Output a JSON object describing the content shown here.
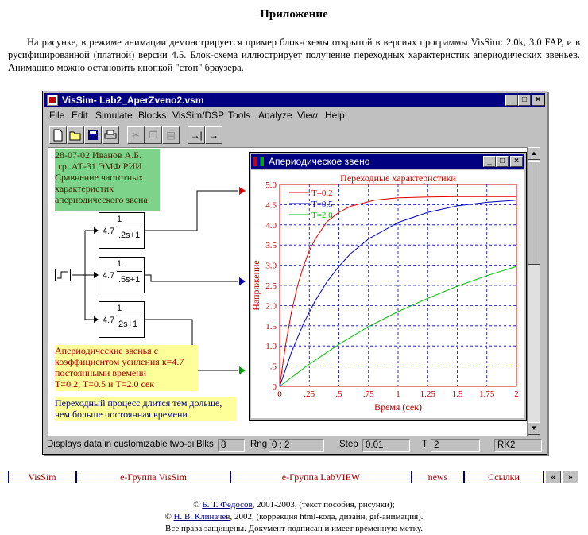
{
  "page": {
    "heading": "Приложение",
    "intro": "На рисунке, в режиме анимации демонстрируется пример блок-схемы открытой в версиях программы VisSim: 2.0k, 3.0 FAP, и в русифицированной (платной) версии 4.5. Блок-схема иллюстрирует получение переходных характеристик апериодических звеньев. Анимацию можно остановить кнопкой \"стоп\" браузера."
  },
  "window": {
    "title": "VisSim- Lab2_AperZveno2.vsm",
    "menu": [
      "File",
      "Edit",
      "Simulate",
      "Blocks",
      "VisSim/DSP",
      "Tools",
      "Analyze",
      "View",
      "Help"
    ],
    "caption_buttons": [
      "_",
      "□",
      "×"
    ]
  },
  "toolbar": {
    "icons": [
      "new-file-icon",
      "open-folder-icon",
      "save-icon",
      "print-icon",
      "cut-icon",
      "copy-icon",
      "paste-icon",
      "step-right-icon",
      "run-right-icon"
    ]
  },
  "diagram": {
    "note_green": [
      "28-07-02 Иванов А.Б.",
      "гр. АТ-31 ЭМФ РИИ",
      "Сравнение частотных",
      "характеристик",
      "апериодического звена"
    ],
    "note_yellow1": [
      "Апериодические звенья с",
      "коэффициентом усиления к=4.7",
      "постоянными времени",
      "T=0.2, T=0.5 и T=2.0 сек"
    ],
    "note_yellow2": [
      "Переходный процесс длится тем дольше,",
      "чем больше постоянная времени."
    ],
    "blocks": [
      {
        "gain": "4.7",
        "num": "1",
        "den": ".2s+1"
      },
      {
        "gain": "4.7",
        "num": "1",
        "den": ".5s+1"
      },
      {
        "gain": "4.7",
        "num": "1",
        "den": "2s+1"
      }
    ],
    "colors": {
      "red": "#e00000",
      "blue": "#0000c0",
      "green": "#00a000"
    }
  },
  "plot": {
    "window_title": "Апериодическое звено",
    "caption_buttons": [
      "_",
      "□",
      "×"
    ]
  },
  "chart_data": {
    "type": "line",
    "title": "Переходные характеристики",
    "xlabel": "Время (сек)",
    "ylabel": "Напряжение",
    "xlim": [
      0,
      2
    ],
    "ylim": [
      0,
      5
    ],
    "xticks": [
      "0",
      ".25",
      ".5",
      ".75",
      "1",
      "1.25",
      "1.5",
      "1.75",
      "2"
    ],
    "yticks": [
      "0",
      ".5",
      "1.0",
      "1.5",
      "2.0",
      "2.5",
      "3.0",
      "3.5",
      "4.0",
      "4.5",
      "5.0"
    ],
    "grid": true,
    "legend_position": "top-left",
    "series": [
      {
        "name": "T=0.2",
        "color": "#e00000",
        "x": [
          0,
          0.05,
          0.1,
          0.15,
          0.2,
          0.25,
          0.3,
          0.4,
          0.5,
          0.6,
          0.8,
          1.0,
          1.25,
          1.5,
          1.75,
          2.0
        ],
        "y": [
          0,
          1.04,
          1.85,
          2.48,
          2.97,
          3.36,
          3.65,
          4.08,
          4.31,
          4.46,
          4.61,
          4.67,
          4.69,
          4.7,
          4.7,
          4.7
        ]
      },
      {
        "name": "T=0.5",
        "color": "#0000c0",
        "x": [
          0,
          0.1,
          0.2,
          0.3,
          0.4,
          0.5,
          0.6,
          0.75,
          1.0,
          1.25,
          1.5,
          1.75,
          2.0
        ],
        "y": [
          0,
          0.85,
          1.55,
          2.12,
          2.59,
          2.97,
          3.29,
          3.65,
          4.06,
          4.31,
          4.47,
          4.56,
          4.61
        ]
      },
      {
        "name": "T=2.0",
        "color": "#00c000",
        "x": [
          0,
          0.25,
          0.5,
          0.75,
          1.0,
          1.25,
          1.5,
          1.75,
          2.0
        ],
        "y": [
          0,
          0.55,
          1.04,
          1.48,
          1.85,
          2.18,
          2.48,
          2.74,
          2.97
        ]
      }
    ]
  },
  "status": {
    "message": "Displays data in customizable two-dimensio",
    "blks_label": "Blks",
    "blks_value": "8",
    "rng_label": "Rng",
    "rng_value": "0 : 2",
    "step_label": "Step",
    "step_value": "0.01",
    "t_label": "T",
    "t_value": "2",
    "method": "RK2"
  },
  "nav": {
    "items": [
      "VisSim",
      "e-Группа VisSim",
      "e-Группа LabVIEW",
      "news",
      "Ссылки"
    ],
    "prev": "«",
    "next": "»"
  },
  "footer": {
    "line1_pre": "© ",
    "author1": "Б. Т. Федосов",
    "line1_post": ", 2001-2003, (текст пособия, рисунки);",
    "line2_pre": "© ",
    "author2": "Н. В. Клиначёв",
    "line2_post": ", 2002, (коррекция html-кода, дизайн, gif-анимация).",
    "line3": "Все права защищены. Документ подписан и имеет временную метку."
  }
}
